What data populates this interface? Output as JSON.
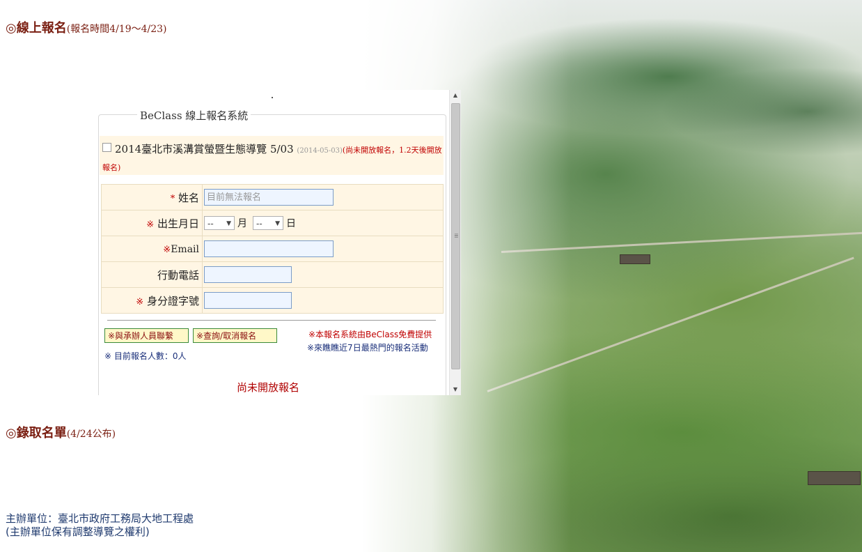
{
  "registration_heading": {
    "title": "◎線上報名",
    "note": "(報名時間4/19～4/23)"
  },
  "admission_heading": {
    "title": "◎錄取名單",
    "note": "(4/24公布)"
  },
  "organizer": {
    "line1": "主辦單位：臺北市政府工務局大地工程處",
    "line2": "(主辦單位保有調整導覽之權利)"
  },
  "beclass": {
    "legend": "BeClass 線上報名系統",
    "event_title": "2014臺北市溪溝賞螢暨生態導覽 5/03",
    "event_date": "(2014-05-03)",
    "event_status": "(尚未開放報名，1.2天後開放報名)",
    "fields": {
      "name_label": "姓名",
      "name_placeholder": "目前無法報名",
      "birthday_label": "出生月日",
      "month_value": "--",
      "month_unit": "月",
      "day_value": "--",
      "day_unit": "日",
      "email_label": "Email",
      "mobile_label": "行動電話",
      "id_label": "身分證字號",
      "required_mark": "※",
      "required_star": "*"
    },
    "buttons": {
      "contact": "※與承辦人員聯繫",
      "query": "※查詢/取消報名"
    },
    "count": "※ 目前報名人數：0人",
    "link_free": "※本報名系統由BeClass免費提供",
    "link_hot": "※來瞧瞧近7日最熱門的報名活動",
    "closed_text": "尚未開放報名"
  },
  "icons": {
    "scroll_up": "scroll-up-arrow-icon",
    "scroll_down": "scroll-down-arrow-icon",
    "dropdown": "chevron-down-icon"
  }
}
